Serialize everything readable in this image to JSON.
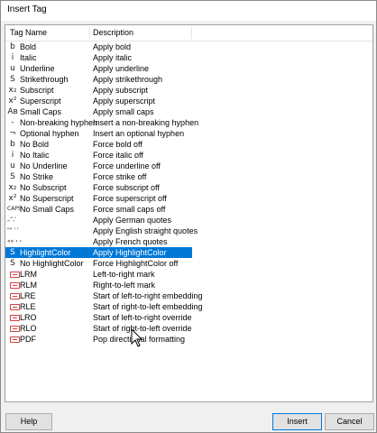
{
  "window": {
    "title": "Insert Tag"
  },
  "columns": {
    "name": "Tag Name",
    "description": "Description"
  },
  "rows": [
    {
      "icon": "bold-icon",
      "glyph": "b",
      "name": "Bold",
      "description": "Apply bold"
    },
    {
      "icon": "italic-icon",
      "glyph": "i",
      "name": "Italic",
      "description": "Apply italic"
    },
    {
      "icon": "underline-icon",
      "glyph": "u",
      "name": "Underline",
      "description": "Apply underline"
    },
    {
      "icon": "strikethrough-icon",
      "glyph": "S",
      "name": "Strikethrough",
      "description": "Apply strikethrough"
    },
    {
      "icon": "subscript-icon",
      "glyph": "x₂",
      "name": "Subscript",
      "description": "Apply subscript"
    },
    {
      "icon": "superscript-icon",
      "glyph": "x²",
      "name": "Superscript",
      "description": "Apply superscript"
    },
    {
      "icon": "small-caps-icon",
      "glyph": "Aʙ",
      "name": "Small Caps",
      "description": "Apply small caps"
    },
    {
      "icon": "nonbreaking-hyphen-icon",
      "glyph": "-",
      "name": "Non-breaking hyphen",
      "description": "Insert a non-breaking hyphen"
    },
    {
      "icon": "optional-hyphen-icon",
      "glyph": "¬",
      "name": "Optional hyphen",
      "description": "Insert an optional hyphen"
    },
    {
      "icon": "no-bold-icon",
      "glyph": "b",
      "name": "No Bold",
      "description": "Force bold off"
    },
    {
      "icon": "no-italic-icon",
      "glyph": "i",
      "name": "No Italic",
      "description": "Force italic off"
    },
    {
      "icon": "no-underline-icon",
      "glyph": "u",
      "name": "No Underline",
      "description": "Force underline off"
    },
    {
      "icon": "no-strike-icon",
      "glyph": "S",
      "name": "No Strike",
      "description": "Force strike off"
    },
    {
      "icon": "no-subscript-icon",
      "glyph": "x₂",
      "name": "No Subscript",
      "description": "Force subscript off"
    },
    {
      "icon": "no-superscript-icon",
      "glyph": "x²",
      "name": "No Superscript",
      "description": "Force superscript off"
    },
    {
      "icon": "no-small-caps-icon",
      "glyph": "CAPS",
      "name": "No Small Caps",
      "description": "Force small caps off"
    },
    {
      "icon": "german-quotes-icon",
      "glyph": "„“‚‘",
      "name": "",
      "description": "Apply German quotes"
    },
    {
      "icon": "english-quotes-icon",
      "glyph": "\"\" ' '",
      "name": "",
      "description": "Apply English straight quotes"
    },
    {
      "icon": "french-quotes-icon",
      "glyph": "«» ‹ ›",
      "name": "",
      "description": "Apply French quotes"
    },
    {
      "icon": "highlight-color-icon",
      "glyph": "S",
      "name": "HighlightColor",
      "description": "Apply HighlightColor",
      "selected": true
    },
    {
      "icon": "no-highlight-color-icon",
      "glyph": "S",
      "name": "No HighlightColor",
      "description": "Force HighlightColor off"
    },
    {
      "icon": "lrm-icon",
      "glyph": "",
      "name": "LRM",
      "description": "Left-to-right mark"
    },
    {
      "icon": "rlm-icon",
      "glyph": "",
      "name": "RLM",
      "description": "Right-to-left mark"
    },
    {
      "icon": "lre-icon",
      "glyph": "",
      "name": "LRE",
      "description": "Start of left-to-right embedding"
    },
    {
      "icon": "rle-icon",
      "glyph": "",
      "name": "RLE",
      "description": "Start of right-to-left embedding"
    },
    {
      "icon": "lro-icon",
      "glyph": "",
      "name": "LRO",
      "description": "Start of left-to-right override"
    },
    {
      "icon": "rlo-icon",
      "glyph": "",
      "name": "RLO",
      "description": "Start of right-to-left override"
    },
    {
      "icon": "pdf-icon",
      "glyph": "",
      "name": "PDF",
      "description": "Pop directional formatting"
    }
  ],
  "buttons": {
    "help": "Help",
    "insert": "Insert",
    "cancel": "Cancel"
  },
  "colors": {
    "selection": "#0078d7",
    "directional_icon": "#d04040"
  }
}
